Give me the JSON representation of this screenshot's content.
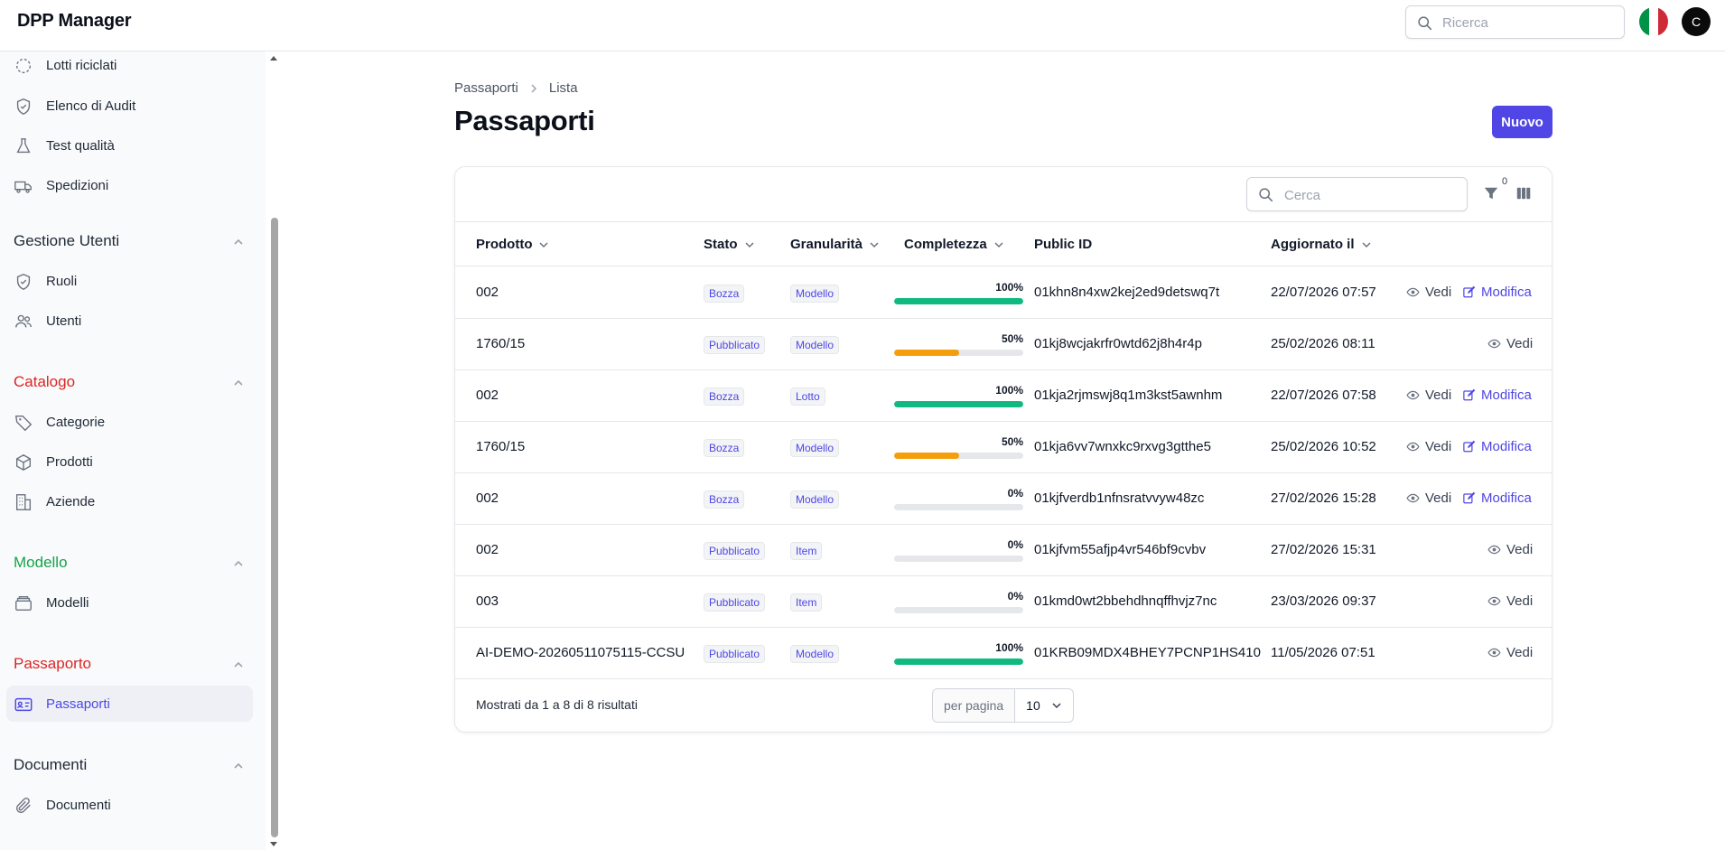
{
  "app": {
    "title": "DPP Manager"
  },
  "top_search": {
    "placeholder": "Ricerca"
  },
  "user": {
    "avatar_initial": "C"
  },
  "sidebar": {
    "items_top": [
      {
        "label": "Lotti riciclati",
        "icon": "recycle-icon"
      },
      {
        "label": "Elenco di Audit",
        "icon": "shield-check-icon"
      },
      {
        "label": "Test qualità",
        "icon": "flask-icon"
      },
      {
        "label": "Spedizioni",
        "icon": "truck-icon"
      }
    ],
    "groups": [
      {
        "label": "Gestione Utenti",
        "color": "#1f2937",
        "items": [
          {
            "label": "Ruoli",
            "icon": "shield-check-icon"
          },
          {
            "label": "Utenti",
            "icon": "users-icon"
          }
        ]
      },
      {
        "label": "Catalogo",
        "color": "#dc2626",
        "items": [
          {
            "label": "Categorie",
            "icon": "tag-icon"
          },
          {
            "label": "Prodotti",
            "icon": "cube-icon"
          },
          {
            "label": "Aziende",
            "icon": "building-icon"
          }
        ]
      },
      {
        "label": "Modello",
        "color": "#16a34a",
        "items": [
          {
            "label": "Modelli",
            "icon": "archive-icon"
          }
        ]
      },
      {
        "label": "Passaporto",
        "color": "#dc2626",
        "items": [
          {
            "label": "Passaporti",
            "icon": "id-card-icon",
            "active": true
          }
        ]
      },
      {
        "label": "Documenti",
        "color": "#1f2937",
        "items": [
          {
            "label": "Documenti",
            "icon": "paperclip-icon"
          }
        ]
      }
    ]
  },
  "breadcrumb": {
    "root": "Passaporti",
    "current": "Lista"
  },
  "page": {
    "title": "Passaporti",
    "new_button": "Nuovo"
  },
  "table": {
    "search_placeholder": "Cerca",
    "filter_count": "0",
    "columns": {
      "product": "Prodotto",
      "status": "Stato",
      "granularity": "Granularità",
      "completeness": "Completezza",
      "public_id": "Public ID",
      "updated": "Aggiornato il"
    },
    "view_label": "Vedi",
    "edit_label": "Modifica",
    "rows": [
      {
        "product": "002",
        "status": "Bozza",
        "granularity": "Modello",
        "completeness": 100,
        "completeness_label": "100%",
        "public_id": "01khn8n4xw2kej2ed9detswq7t",
        "updated": "22/07/2026 07:57",
        "editable": true
      },
      {
        "product": "1760/15",
        "status": "Pubblicato",
        "granularity": "Modello",
        "completeness": 50,
        "completeness_label": "50%",
        "public_id": "01kj8wcjakrfr0wtd62j8h4r4p",
        "updated": "25/02/2026 08:11",
        "editable": false
      },
      {
        "product": "002",
        "status": "Bozza",
        "granularity": "Lotto",
        "completeness": 100,
        "completeness_label": "100%",
        "public_id": "01kja2rjmswj8q1m3kst5awnhm",
        "updated": "22/07/2026 07:58",
        "editable": true
      },
      {
        "product": "1760/15",
        "status": "Bozza",
        "granularity": "Modello",
        "completeness": 50,
        "completeness_label": "50%",
        "public_id": "01kja6vv7wnxkc9rxvg3gtthe5",
        "updated": "25/02/2026 10:52",
        "editable": true
      },
      {
        "product": "002",
        "status": "Bozza",
        "granularity": "Modello",
        "completeness": 0,
        "completeness_label": "0%",
        "public_id": "01kjfverdb1nfnsratvvyw48zc",
        "updated": "27/02/2026 15:28",
        "editable": true
      },
      {
        "product": "002",
        "status": "Pubblicato",
        "granularity": "Item",
        "completeness": 0,
        "completeness_label": "0%",
        "public_id": "01kjfvm55afjp4vr546bf9cvbv",
        "updated": "27/02/2026 15:31",
        "editable": false
      },
      {
        "product": "003",
        "status": "Pubblicato",
        "granularity": "Item",
        "completeness": 0,
        "completeness_label": "0%",
        "public_id": "01kmd0wt2bbehdhnqffhvjz7nc",
        "updated": "23/03/2026 09:37",
        "editable": false
      },
      {
        "product": "AI-DEMO-20260511075115-CCSU",
        "status": "Pubblicato",
        "granularity": "Modello",
        "completeness": 100,
        "completeness_label": "100%",
        "public_id": "01KRB09MDX4BHEY7PCNP1HS410",
        "updated": "11/05/2026 07:51",
        "editable": false
      }
    ],
    "results_text": "Mostrati da 1 a 8 di 8 risultati",
    "per_page_label": "per pagina",
    "per_page_value": "10"
  },
  "colors": {
    "accent": "#4f46e5",
    "bar_full": "#10b981",
    "bar_half": "#f59e0b",
    "bar_empty": "#e5e7eb"
  }
}
